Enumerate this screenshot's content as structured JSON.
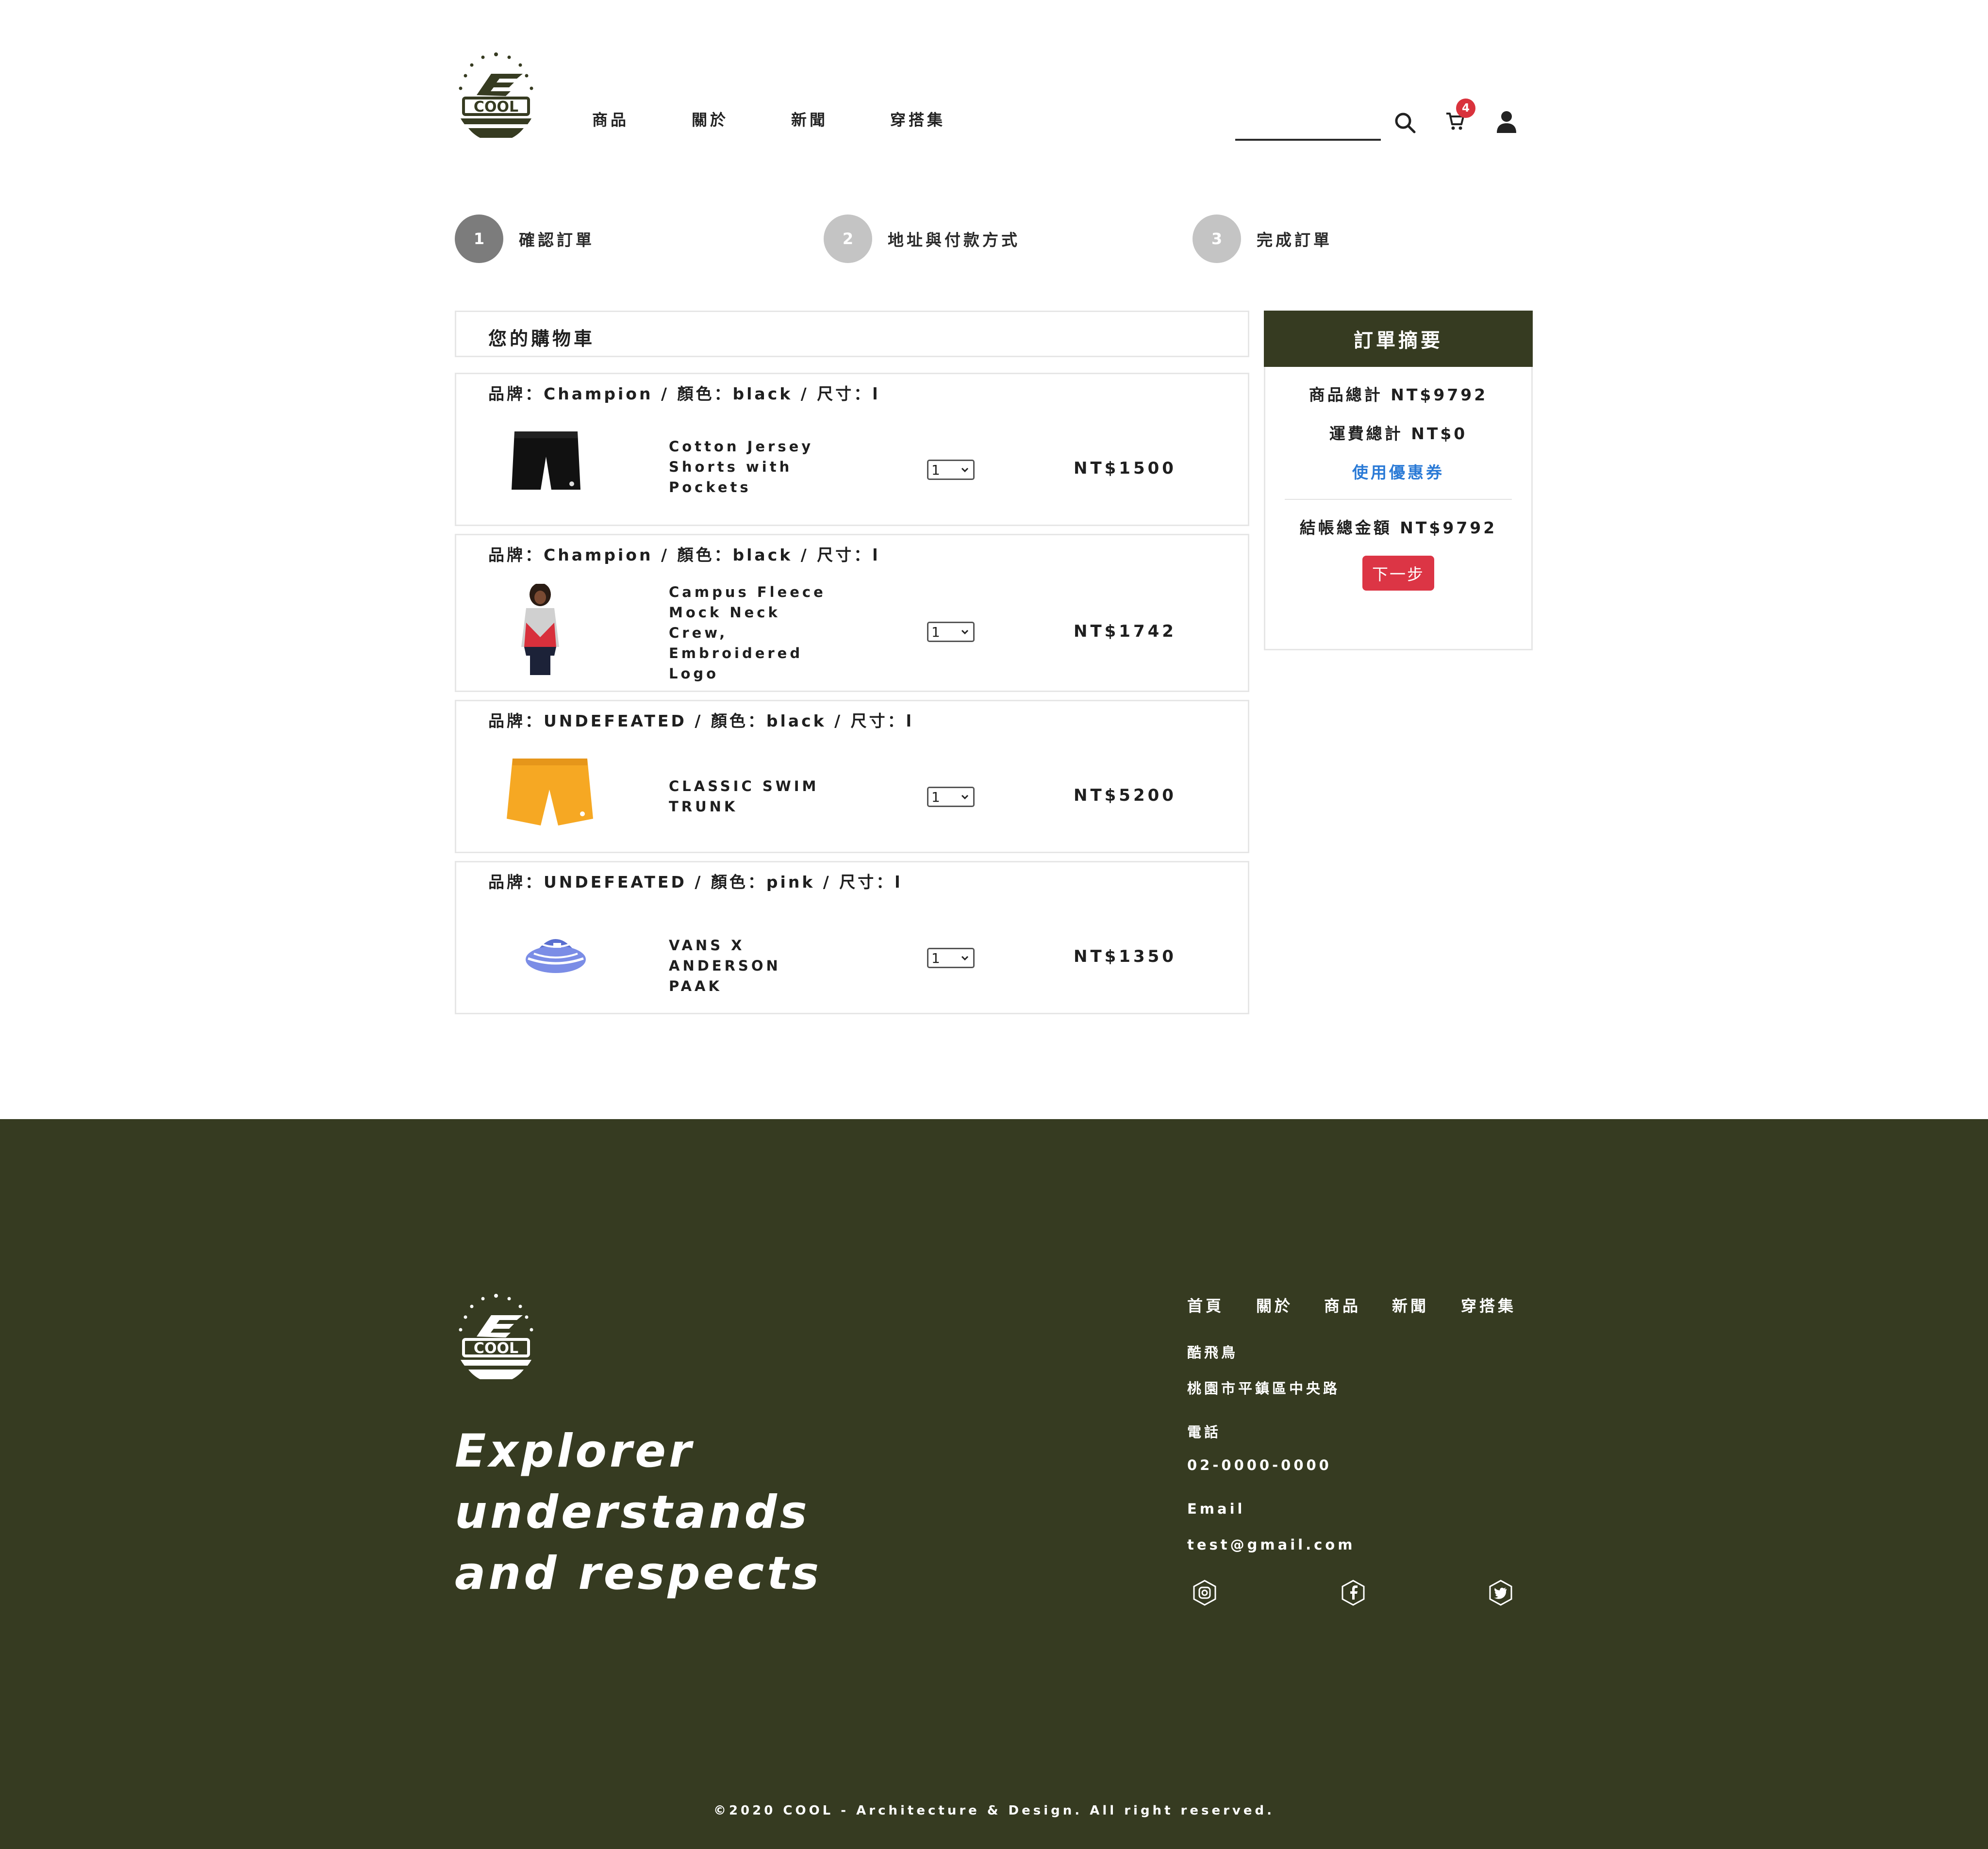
{
  "brand": {
    "logo_text": "COOL"
  },
  "nav": {
    "items": [
      "商品",
      "關於",
      "新聞",
      "穿搭集"
    ]
  },
  "cart": {
    "badge_count": "4",
    "badge_color": "#d9323c"
  },
  "steps": [
    {
      "number": "1",
      "label": "確認訂單",
      "color": "#7c7c7c"
    },
    {
      "number": "2",
      "label": "地址與付款方式",
      "color": "#c4c4c4"
    },
    {
      "number": "3",
      "label": "完成訂單",
      "color": "#c4c4c4"
    }
  ],
  "cart_list": {
    "title": "您的購物車",
    "items": [
      {
        "meta": "品牌：Champion / 顏色：black / 尺寸：l",
        "name": "Cotton Jersey Shorts with Pockets",
        "qty": "1",
        "price": "NT$1500",
        "image": "black-shorts"
      },
      {
        "meta": "品牌：Champion / 顏色：black / 尺寸：l",
        "name": "Campus Fleece Mock Neck Crew, Embroidered Logo",
        "qty": "1",
        "price": "NT$1742",
        "image": "fleece-top"
      },
      {
        "meta": "品牌：UNDEFEATED / 顏色：black / 尺寸：l",
        "name": "CLASSIC SWIM TRUNK",
        "qty": "1",
        "price": "NT$5200",
        "image": "yellow-trunk"
      },
      {
        "meta": "品牌：UNDEFEATED / 顏色：pink / 尺寸：l",
        "name": "VANS X ANDERSON PAAK",
        "qty": "1",
        "price": "NT$1350",
        "image": "bucket-hat"
      }
    ]
  },
  "summary": {
    "title": "訂單摘要",
    "subtotal": "商品總計 NT$9792",
    "shipping": "運費總計 NT$0",
    "coupon": "使用優惠券",
    "total": "結帳總金額 NT$9792",
    "next_button": "下一步",
    "header_color": "#363b21",
    "button_color": "#dc3545"
  },
  "footer": {
    "slogan_lines": [
      "Explorer",
      "understands",
      "and respects"
    ],
    "nav": [
      "首頁",
      "關於",
      "商品",
      "新聞",
      "穿搭集"
    ],
    "company": "酷飛鳥",
    "address": "桃園市平鎮區中央路",
    "phone_label": "電話",
    "phone": "02-0000-0000",
    "email_label": "Email",
    "email": "test@gmail.com",
    "social": [
      "instagram-icon",
      "facebook-icon",
      "twitter-icon"
    ],
    "copyright": "©2020 COOL - Architecture & Design. All right reserved.",
    "background": "#363b21"
  }
}
